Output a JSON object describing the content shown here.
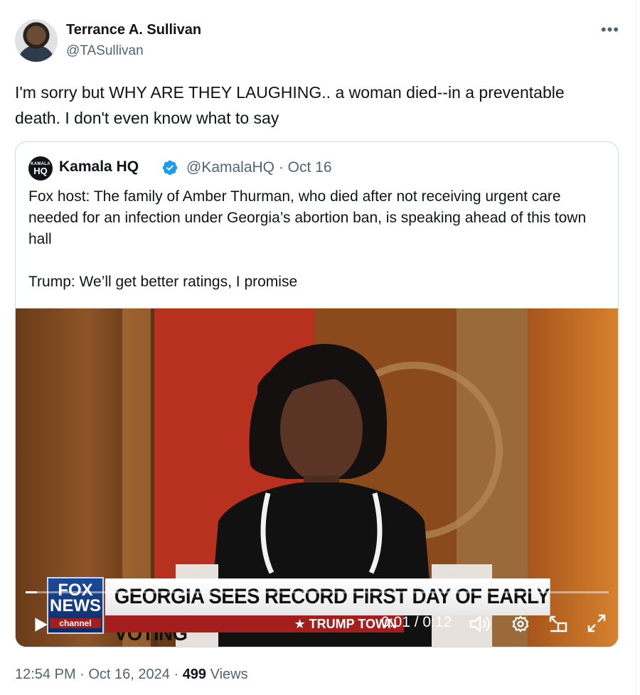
{
  "author": {
    "name": "Terrance A. Sullivan",
    "handle": "@TASullivan"
  },
  "tweet": {
    "text": "I'm sorry but WHY ARE THEY LAUGHING.. a woman died--in a preventable death. I don't even know what to say",
    "more_icon": "more-horizontal-icon"
  },
  "quoted": {
    "logo_small": "KAMALA",
    "logo_text": "HQ",
    "name": "Kamala HQ",
    "verified_icon": "verified-badge-icon",
    "handle_date": "@KamalaHQ · Oct 16",
    "paragraphs": [
      "Fox host: The family of Amber Thurman, who died after not receiving urgent care needed for an infection under Georgia’s abortion ban, is speaking ahead of this town hall",
      "Trump: We’ll get better ratings, I promise"
    ]
  },
  "video": {
    "chyron_headline": "GEORGIA SEES RECORD FIRST DAY OF EARLY VOTING",
    "chyron_sub": "★ TRUMP TOWN",
    "logo_fox": "FOX",
    "logo_news": "NEWS",
    "logo_channel": "channel",
    "time": "0:01 / 0:12",
    "progress": 0.02,
    "icons": [
      "play-icon",
      "volume-icon",
      "settings-gear-icon",
      "picture-in-picture-icon",
      "fullscreen-icon"
    ],
    "accent": "#a51e1e"
  },
  "meta": {
    "time_date": "12:54 PM · Oct 16, 2024 · ",
    "views_count": "499",
    "views_label": " Views"
  }
}
